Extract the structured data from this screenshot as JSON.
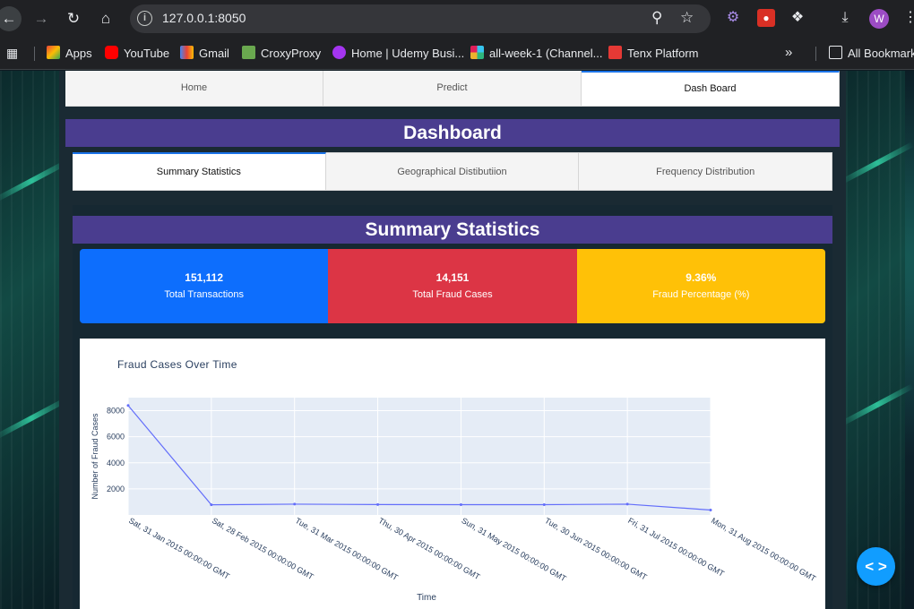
{
  "browser": {
    "url": "127.0.0.1:8050",
    "profile_initial": "W",
    "bookmarks": [
      {
        "label": "Apps",
        "icon": "apps-icon",
        "color": "#e8453c"
      },
      {
        "label": "YouTube",
        "icon": "youtube-icon",
        "color": "#ff0000"
      },
      {
        "label": "Gmail",
        "icon": "gmail-icon",
        "color": "#ea4335"
      },
      {
        "label": "CroxyProxy",
        "icon": "croxyproxy-icon",
        "color": "#6aa84f"
      },
      {
        "label": "Home | Udemy Busi...",
        "icon": "udemy-icon",
        "color": "#a435f0"
      },
      {
        "label": "all-week-1 (Channel...",
        "icon": "slack-icon",
        "color": "#e01e5a"
      },
      {
        "label": "Tenx Platform",
        "icon": "tenx-icon",
        "color": "#e53935"
      }
    ],
    "all_bookmarks_label": "All Bookmarks"
  },
  "nav": {
    "tabs": [
      "Home",
      "Predict",
      "Dash Board"
    ],
    "active": "Dash Board"
  },
  "dashboard": {
    "title": "Dashboard",
    "sub_tabs": [
      "Summary Statistics",
      "Geographical Distibutiion",
      "Frequency Distribution"
    ],
    "active_sub_tab": "Summary Statistics",
    "section_title": "Summary Statistics",
    "cards": [
      {
        "value": "151,112",
        "label": "Total Transactions",
        "color": "#0d6efd"
      },
      {
        "value": "14,151",
        "label": "Total Fraud Cases",
        "color": "#dc3545"
      },
      {
        "value": "9.36%",
        "label": "Fraud Percentage (%)",
        "color": "#ffc107"
      }
    ]
  },
  "colors": {
    "banner": "#4a3d8f",
    "plot_bg": "#e5ecf6",
    "line": "#636efa",
    "fab": "#119dff"
  },
  "chart_data": {
    "type": "line",
    "title": "Fraud Cases Over Time",
    "xlabel": "Time",
    "ylabel": "Number of Fraud Cases",
    "x": [
      "Sat, 31 Jan 2015 00:00:00 GMT",
      "Sat, 28 Feb 2015 00:00:00 GMT",
      "Tue, 31 Mar 2015 00:00:00 GMT",
      "Thu, 30 Apr 2015 00:00:00 GMT",
      "Sun, 31 May 2015 00:00:00 GMT",
      "Tue, 30 Jun 2015 00:00:00 GMT",
      "Fri, 31 Jul 2015 00:00:00 GMT",
      "Mon, 31 Aug 2015 00:00:00 GMT"
    ],
    "values": [
      8400,
      780,
      830,
      800,
      790,
      790,
      830,
      380
    ],
    "ylim": [
      0,
      9000
    ],
    "yticks": [
      2000,
      4000,
      6000,
      8000
    ],
    "grid": true
  }
}
